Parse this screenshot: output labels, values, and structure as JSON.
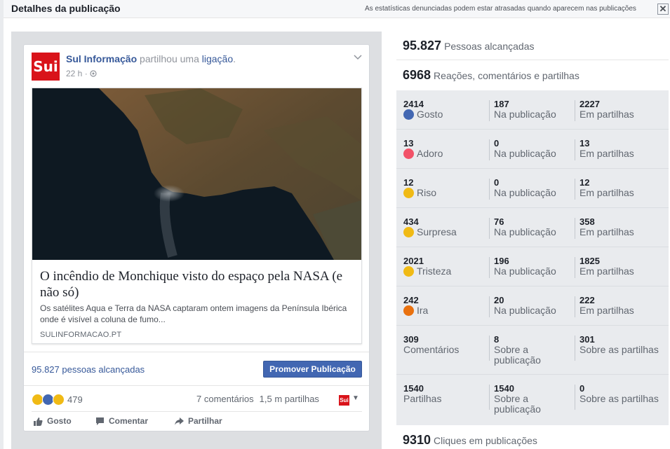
{
  "dialog": {
    "title": "Detalhes da publicação",
    "note": "As estatísticas denunciadas podem estar atrasadas quando aparecem nas publicações",
    "close_symbol": "✕"
  },
  "post": {
    "avatar_text": "Sui",
    "author": "Sul Informação",
    "action": " partilhou uma ",
    "link_word": "ligação",
    "period": ".",
    "time": "22 h",
    "dot": " · ",
    "link": {
      "title": "O incêndio de Monchique visto do espaço pela NASA (e não só)",
      "description": "Os satélites Aqua e Terra da NASA captaram ontem imagens da Península Ibérica onde é visível a coluna de fumo...",
      "domain": "SULINFORMACAO.PT"
    },
    "reach_text": "95.827 pessoas alcançadas",
    "promote_label": "Promover Publicação",
    "reaction_count": "479",
    "comments_text": "7 comentários",
    "shares_text": "1,5 m partilhas",
    "page_mini_text": "Sui",
    "actions": {
      "like": "Gosto",
      "comment": "Comentar",
      "share": "Partilhar"
    }
  },
  "stats": {
    "reach_num": "95.827",
    "reach_label": "Pessoas alcançadas",
    "engagement_num": "6968",
    "engagement_label": "Reações, comentários e partilhas",
    "rows": [
      {
        "total": "2414",
        "label": "Gosto",
        "on_post": "187",
        "on_post_label": "Na publicação",
        "on_shares": "2227",
        "on_shares_label": "Em partilhas"
      },
      {
        "total": "13",
        "label": "Adoro",
        "on_post": "0",
        "on_post_label": "Na publicação",
        "on_shares": "13",
        "on_shares_label": "Em partilhas"
      },
      {
        "total": "12",
        "label": "Riso",
        "on_post": "0",
        "on_post_label": "Na publicação",
        "on_shares": "12",
        "on_shares_label": "Em partilhas"
      },
      {
        "total": "434",
        "label": "Surpresa",
        "on_post": "76",
        "on_post_label": "Na publicação",
        "on_shares": "358",
        "on_shares_label": "Em partilhas"
      },
      {
        "total": "2021",
        "label": "Tristeza",
        "on_post": "196",
        "on_post_label": "Na publicação",
        "on_shares": "1825",
        "on_shares_label": "Em partilhas"
      },
      {
        "total": "242",
        "label": "Ira",
        "on_post": "20",
        "on_post_label": "Na publicação",
        "on_shares": "222",
        "on_shares_label": "Em partilhas"
      },
      {
        "total": "309",
        "label": "Comentários",
        "on_post": "8",
        "on_post_label_1": "Sobre a",
        "on_post_label_2": "publicação",
        "on_shares": "301",
        "on_shares_label": "Sobre as partilhas"
      },
      {
        "total": "1540",
        "label": "Partilhas",
        "on_post": "1540",
        "on_post_label_1": "Sobre a",
        "on_post_label_2": "publicação",
        "on_shares": "0",
        "on_shares_label": "Sobre as partilhas"
      }
    ],
    "clicks_num": "9310",
    "clicks_label": "Cliques em publicações"
  },
  "colors": {
    "brand_blue": "#4267b2",
    "link_blue": "#365899",
    "sul_red": "#d9131a",
    "love_red": "#f25268",
    "angry_orange": "#e9710f",
    "yellow": "#f0ba15"
  }
}
